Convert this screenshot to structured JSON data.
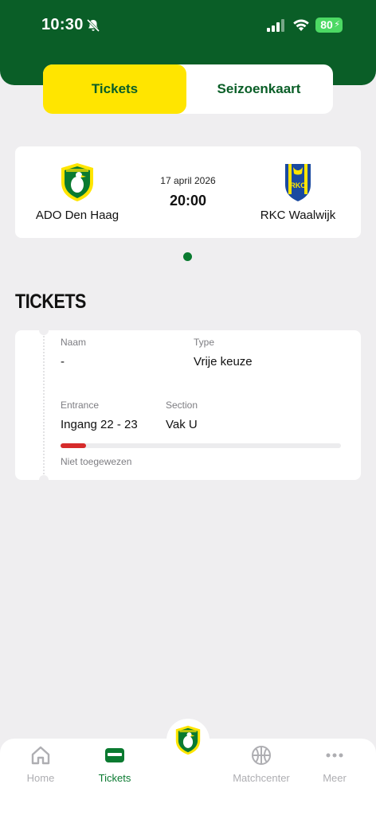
{
  "status_bar": {
    "time": "10:30",
    "battery": "80"
  },
  "segments": {
    "tickets": "Tickets",
    "season_card": "Seizoenkaart"
  },
  "match": {
    "home_team": "ADO Den Haag",
    "away_team": "RKC Waalwijk",
    "date": "17 april 2026",
    "time": "20:00"
  },
  "section_title": "TICKETS",
  "ticket": {
    "name_label": "Naam",
    "name_value": "-",
    "type_label": "Type",
    "type_value": "Vrije keuze",
    "entrance_label": "Entrance",
    "entrance_value": "Ingang 22 - 23",
    "section_label": "Section",
    "section_value": "Vak U",
    "assignment_progress": 0.09,
    "status": "Niet toegewezen"
  },
  "colors": {
    "brand_green": "#0a5e27",
    "brand_yellow": "#ffe500",
    "accent_green": "#0a7a30",
    "alert_red": "#d62b2b"
  },
  "tabbar": {
    "home": "Home",
    "tickets": "Tickets",
    "matchcenter": "Matchcenter",
    "more": "Meer"
  }
}
